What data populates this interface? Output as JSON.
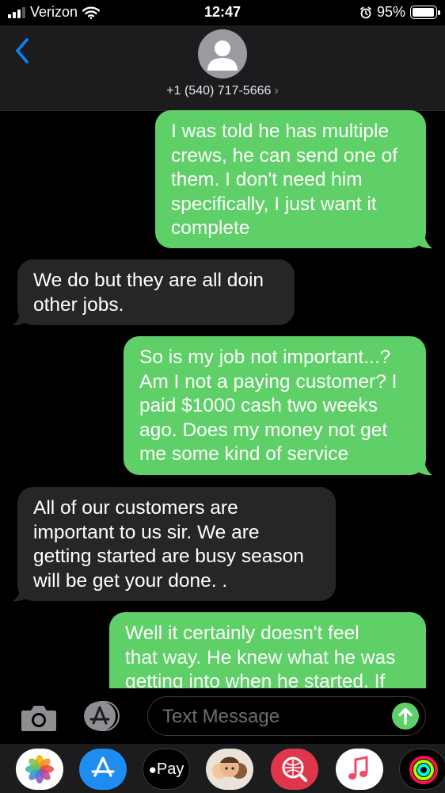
{
  "status_bar": {
    "carrier": "Verizon",
    "time": "12:47",
    "battery_percent": "95%",
    "battery_level": 0.95,
    "icons": [
      "signal-icon",
      "wifi-icon",
      "alarm-icon",
      "battery-icon"
    ]
  },
  "header": {
    "contact": "+1 (540) 717-5666",
    "chevron": "›",
    "icons": [
      "back-chevron-icon",
      "contact-avatar-icon"
    ]
  },
  "messages": [
    {
      "direction": "sent",
      "lines": [
        "I was told he has multiple",
        "crews, he can send one of",
        "them. I don't need him",
        "specifically, I just want it",
        "complete"
      ]
    },
    {
      "direction": "received",
      "lines": [
        "We do but they are all doin",
        "other jobs."
      ]
    },
    {
      "direction": "sent",
      "lines": [
        "So is my job not important...?",
        "Am I not a paying customer? I",
        "paid $1000 cash two weeks",
        "ago. Does my money not get",
        "me some kind of service"
      ]
    },
    {
      "direction": "received",
      "lines": [
        "All of our customers are",
        "important to us sir. We are",
        "getting started are busy season",
        "will be get your done. ."
      ]
    },
    {
      "direction": "sent",
      "lines": [
        "Well it certainly doesn't feel",
        "that way. He knew what he was",
        "getting into when he started. If"
      ]
    }
  ],
  "input_bar": {
    "placeholder": "Text Message",
    "icons": [
      "camera-icon",
      "app-store-icon",
      "send-arrow-icon"
    ]
  },
  "app_strip": {
    "items": [
      {
        "name": "photos-app-icon",
        "label": ""
      },
      {
        "name": "app-store-app-icon",
        "label": ""
      },
      {
        "name": "apple-pay-app-icon",
        "label": "Pay"
      },
      {
        "name": "memoji-app-icon",
        "label": ""
      },
      {
        "name": "image-search-app-icon",
        "label": ""
      },
      {
        "name": "music-app-icon",
        "label": ""
      },
      {
        "name": "activity-app-icon",
        "label": ""
      }
    ]
  },
  "colors": {
    "sent_bubble": "#5fd068",
    "received_bubble": "#262628",
    "accent_blue": "#0a84ff",
    "background": "#000000"
  }
}
